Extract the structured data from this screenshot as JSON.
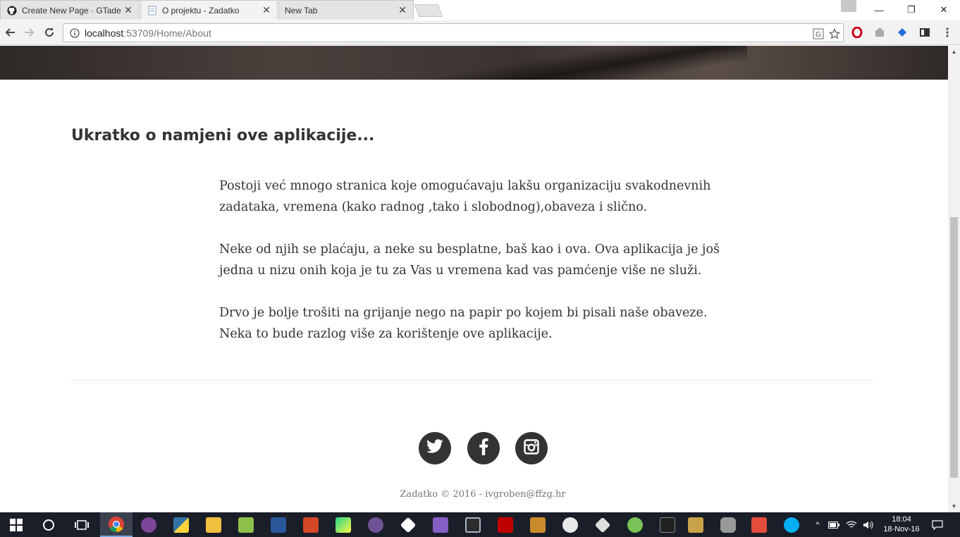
{
  "browser": {
    "tabs": [
      {
        "title": "Create New Page · GTade",
        "icon": "github-icon",
        "active": false
      },
      {
        "title": "O projektu - Zadatko",
        "icon": "document-icon",
        "active": true
      },
      {
        "title": "New Tab",
        "icon": "",
        "active": false
      }
    ],
    "close_glyph": "✕",
    "url_host": "localhost",
    "url_path": ":53709/Home/About"
  },
  "window_controls": {
    "minimize": "—",
    "restore": "❐",
    "close": "✕"
  },
  "page": {
    "title": "Ukratko o namjeni ove aplikacije...",
    "paragraphs": [
      "Postoji već mnogo stranica koje omogućavaju lakšu organizaciju svakodnevnih zadataka, vremena (kako radnog ,tako i slobodnog),obaveza i slično.",
      "Neke od njih se plaćaju, a neke su besplatne, baš kao i ova. Ova aplikacija je još jedna u nizu onih koja je tu za Vas u vremena kad vas pamćenje više ne služi.",
      "Drvo je bolje trošiti na grijanje nego na papir po kojem bi pisali naše obaveze. Neka to bude razlog više za korištenje ove aplikacije."
    ],
    "social": [
      "twitter-icon",
      "facebook-icon",
      "instagram-icon"
    ],
    "footer": "Zadatko © 2016 - ivgroben@ffzg.hr"
  },
  "taskbar": {
    "apps": [
      "start-icon",
      "cortana-icon",
      "task-view-icon",
      "chrome-icon",
      "tor-icon",
      "python-icon",
      "file-explorer-icon",
      "notepad-plus-icon",
      "word-icon",
      "powerpoint-icon",
      "pycharm-icon",
      "github-desktop-icon",
      "unity-icon",
      "visual-studio-icon",
      "media-icon",
      "filezilla-icon",
      "sublime-icon",
      "paint-icon",
      "inkscape-icon",
      "android-studio-icon",
      "terminal-icon",
      "tools-icon",
      "database-icon",
      "sublime-text-icon",
      "skype-icon"
    ],
    "time": "18:04",
    "date": "18-Nov-16",
    "colors": {
      "background": "#1a1e28",
      "active": "#3c4150"
    }
  }
}
